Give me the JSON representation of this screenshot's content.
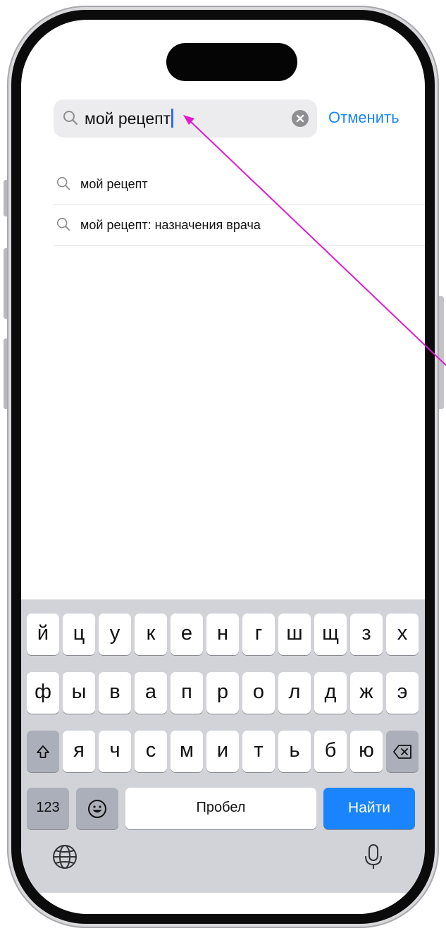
{
  "search": {
    "value": "мой рецепт",
    "cancel_label": "Отменить"
  },
  "suggestions": [
    {
      "text": "мой рецепт"
    },
    {
      "text": "мой рецепт: назначения врача"
    }
  ],
  "keyboard": {
    "row1": [
      "й",
      "ц",
      "у",
      "к",
      "е",
      "н",
      "г",
      "ш",
      "щ",
      "з",
      "х"
    ],
    "row2": [
      "ф",
      "ы",
      "в",
      "а",
      "п",
      "р",
      "о",
      "л",
      "д",
      "ж",
      "э"
    ],
    "row3": [
      "я",
      "ч",
      "с",
      "м",
      "и",
      "т",
      "ь",
      "б",
      "ю"
    ],
    "numbers_label": "123",
    "space_label": "Пробел",
    "search_label": "Найти",
    "icons": {
      "shift": "shift-icon",
      "backspace": "backspace-icon",
      "emoji": "emoji-icon",
      "globe": "globe-icon",
      "microphone": "microphone-icon"
    }
  },
  "colors": {
    "accent": "#1a84ff",
    "annotation_arrow": "#e01ad0"
  }
}
